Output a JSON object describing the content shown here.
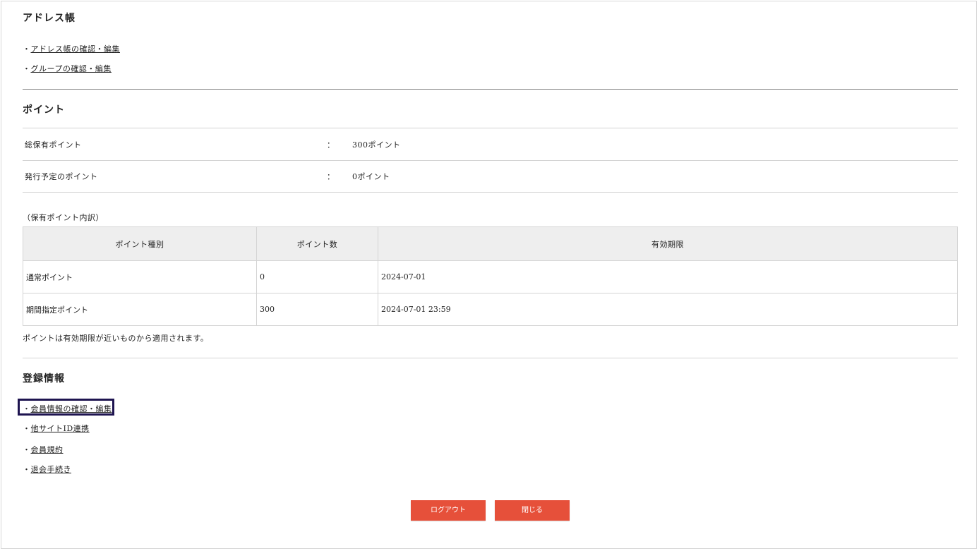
{
  "address_book": {
    "heading": "アドレス帳",
    "links": [
      "アドレス帳の確認・編集",
      "グループの確認・編集"
    ]
  },
  "points": {
    "heading": "ポイント",
    "rows": [
      {
        "label": "総保有ポイント",
        "colon": "：",
        "value": "300ポイント"
      },
      {
        "label": "発行予定のポイント",
        "colon": "：",
        "value": "0ポイント"
      }
    ],
    "breakdown_caption": "（保有ポイント内訳）",
    "table": {
      "headers": [
        "ポイント種別",
        "ポイント数",
        "有効期限"
      ],
      "rows": [
        [
          "通常ポイント",
          "0",
          "2024-07-01"
        ],
        [
          "期間指定ポイント",
          "300",
          "2024-07-01 23:59"
        ]
      ]
    },
    "note": "ポイントは有効期限が近いものから適用されます。"
  },
  "registration": {
    "heading": "登録情報",
    "links": [
      "会員情報の確認・編集",
      "他サイトID連携",
      "会員規約",
      "退会手続き"
    ]
  },
  "bullet": "・",
  "buttons": {
    "logout": "ログアウト",
    "close": "閉じる"
  },
  "colors": {
    "button": "#e6503a",
    "highlight": "#1e1450"
  }
}
